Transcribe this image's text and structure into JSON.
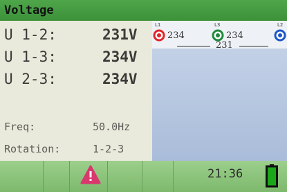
{
  "screen": {
    "title": "Voltage",
    "readings": [
      {
        "label": "U 1-2:",
        "value": "231V"
      },
      {
        "label": "U 1-3:",
        "value": "234V"
      },
      {
        "label": "U 2-3:",
        "value": "234V"
      }
    ],
    "freq": {
      "label": "Freq:",
      "value": "50.0Hz"
    },
    "rotation": {
      "label": "Rotation:",
      "value": "1-2-3"
    }
  },
  "phase_diagram": {
    "terminals": [
      {
        "tag": "L1",
        "color": "#e0242a"
      },
      {
        "tag": "L3",
        "color": "#1e8a3c"
      },
      {
        "tag": "L2",
        "color": "#1e56c8"
      }
    ],
    "values": {
      "l1_l3": "234",
      "l3_l2": "234",
      "l1_l2": "231"
    }
  },
  "status_bar": {
    "time": "21:36",
    "warning_icon": "warning-triangle-icon",
    "warning_color": "#d8386e",
    "battery_icon": "battery-icon",
    "battery_color": "#1aa81a"
  }
}
